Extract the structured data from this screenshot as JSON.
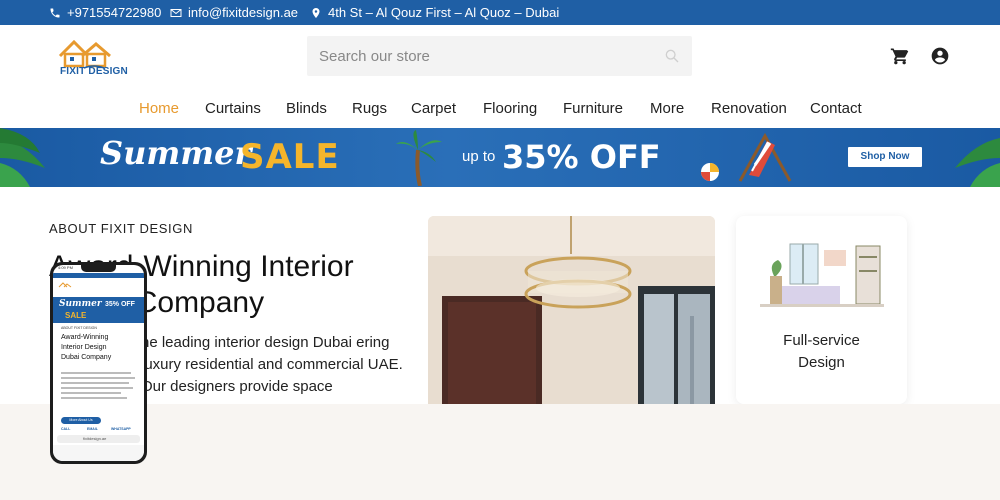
{
  "topbar": {
    "phone": "+971554722980",
    "email": "info@fixitdesign.ae",
    "address": "4th St – Al Qouz First – Al Quoz – Dubai"
  },
  "logo": {
    "text": "FIXIT DESIGN"
  },
  "search": {
    "placeholder": "Search our store"
  },
  "nav": {
    "items": [
      "Home",
      "Curtains",
      "Blinds",
      "Rugs",
      "Carpet",
      "Flooring",
      "Furniture",
      "More",
      "Renovation",
      "Contact"
    ],
    "active": "Home"
  },
  "banner": {
    "summer": "Summer",
    "sale": "SALE",
    "upto": "up to",
    "discount": "35% OFF",
    "cta": "Shop Now"
  },
  "about": {
    "label": "ABOUT FIXIT DESIGN",
    "headline": "Award-Winning Interior Dubai Company",
    "body": "he leading interior design Dubai ering luxury residential and commercial UAE. Our designers provide space"
  },
  "card": {
    "title_line1": "Full-service",
    "title_line2": "Design"
  },
  "phone_mockup": {
    "time": "4:09 PM",
    "banner_summer": "Summer",
    "banner_pct": "35% OFF",
    "banner_sale": "SALE",
    "label": "ABOUT FIXIT DESIGN",
    "headline_1": "Award-Winning",
    "headline_2": "Interior Design",
    "headline_3": "Dubai Company",
    "cta": "More About Us",
    "call": "CALL",
    "email": "EMAIL",
    "whatsapp": "WHATSAPP",
    "url": "fixitdesign.ae"
  },
  "colors": {
    "brand_blue": "#1f5fa5",
    "accent_orange": "#e79a2f",
    "sale_yellow": "#f5b52b",
    "footer_bg": "#f8f5f2"
  }
}
